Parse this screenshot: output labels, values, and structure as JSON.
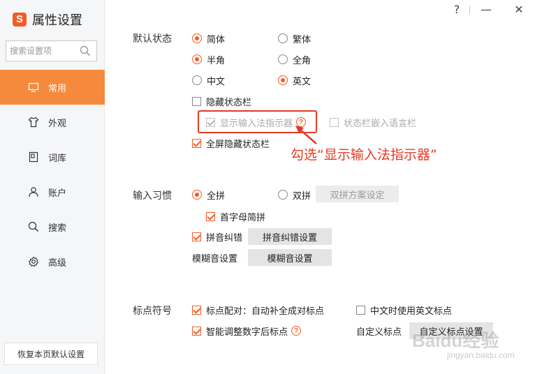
{
  "app": {
    "logo": "S",
    "title": "属性设置"
  },
  "window_controls": {
    "help": "?",
    "minimize": "—",
    "close": "✕"
  },
  "search": {
    "placeholder": "搜索设置项"
  },
  "nav": [
    {
      "label": "常用",
      "icon": "monitor-icon",
      "active": true
    },
    {
      "label": "外观",
      "icon": "shirt-icon"
    },
    {
      "label": "词库",
      "icon": "book-icon"
    },
    {
      "label": "账户",
      "icon": "user-icon"
    },
    {
      "label": "搜索",
      "icon": "search-icon"
    },
    {
      "label": "高级",
      "icon": "gear-icon"
    }
  ],
  "reset_label": "恢复本页默认设置",
  "status": {
    "label": "默认状态",
    "simplified": "简体",
    "traditional": "繁体",
    "halfwidth": "半角",
    "fullwidth": "全角",
    "chinese": "中文",
    "english": "英文",
    "hide_statusbar": "隐藏状态栏",
    "show_indicator": "显示输入法指示器",
    "embed_langbar": "状态栏嵌入语言栏",
    "fullscreen_hide": "全屏隐藏状态栏"
  },
  "annotation": "勾选“显示输入法指示器”",
  "habit": {
    "label": "输入习惯",
    "quanpin": "全拼",
    "shuangpin": "双拼",
    "shuangpin_btn": "双拼方案设定",
    "initials": "首字母简拼",
    "correction": "拼音纠错",
    "correction_btn": "拼音纠错设置",
    "fuzzy_label": "模糊音设置",
    "fuzzy_btn": "模糊音设置"
  },
  "punct": {
    "label": "标点符号",
    "pairing": "标点配对：自动补全成对标点",
    "english_in_chinese": "中文时使用英文标点",
    "smart_digits": "智能调整数字后标点",
    "custom_label": "自定义标点",
    "custom_btn": "自定义标点设置"
  },
  "watermark": {
    "text": "Baidu经验",
    "url": "jingyan.baidu.com"
  },
  "colors": {
    "accent": "#f35d24",
    "nav_active": "#f68a3c",
    "annotation": "#e23a24"
  }
}
